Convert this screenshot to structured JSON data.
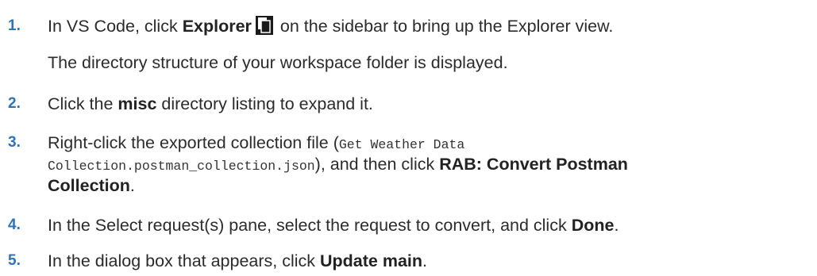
{
  "steps": [
    {
      "number": "1.",
      "text_a": "In VS Code, click ",
      "bold_a": "Explorer",
      "icon": "explorer-icon",
      "text_b": " on the sidebar to bring up the Explorer view.",
      "result": "The directory structure of your workspace folder is displayed."
    },
    {
      "number": "2.",
      "text_a": "Click the ",
      "bold_a": "misc",
      "text_b": " directory listing to expand it."
    },
    {
      "number": "3.",
      "text_a": "Right-click the exported collection file (",
      "code_line1": "Get Weather Data",
      "code_line2": "Collection.postman_collection.json",
      "text_b": "), and then click ",
      "bold_a": "RAB: Convert Postman",
      "bold_b": "Collection",
      "text_c": "."
    },
    {
      "number": "4.",
      "text_a": "In the Select request(s) pane, select the request to convert, and click ",
      "bold_a": "Done",
      "text_b": "."
    },
    {
      "number": "5.",
      "text_a": "In the dialog box that appears, click ",
      "bold_a": "Update main",
      "text_b": "."
    }
  ]
}
